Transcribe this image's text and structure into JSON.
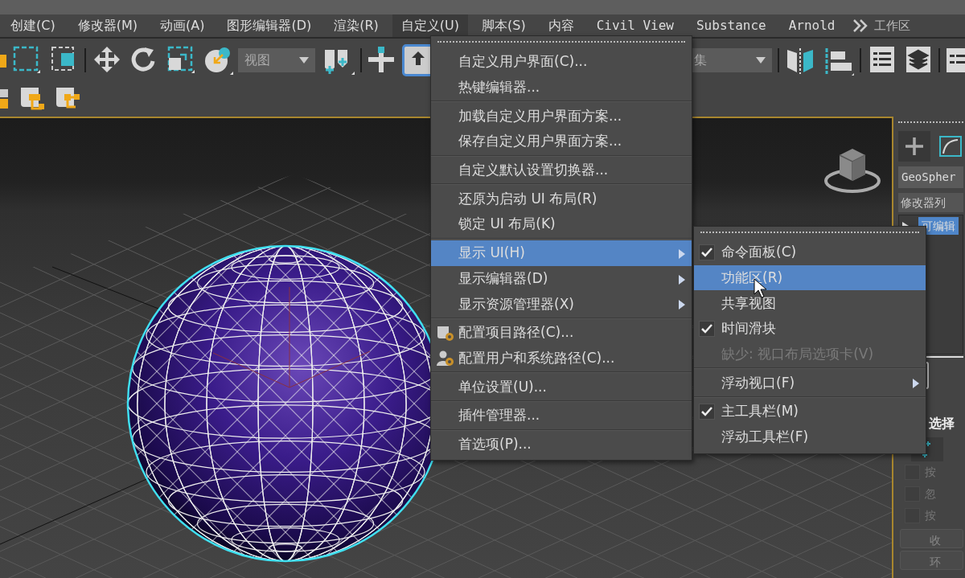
{
  "menu_bar": {
    "items": [
      {
        "label": "创建(C)",
        "selected": false
      },
      {
        "label": "修改器(M)",
        "selected": false
      },
      {
        "label": "动画(A)",
        "selected": false
      },
      {
        "label": "图形编辑器(D)",
        "selected": false
      },
      {
        "label": "渲染(R)",
        "selected": false
      },
      {
        "label": "自定义(U)",
        "selected": true
      },
      {
        "label": "脚本(S)",
        "selected": false
      },
      {
        "label": "内容",
        "selected": false
      },
      {
        "label": "Civil View",
        "selected": false
      },
      {
        "label": "Substance",
        "selected": false
      },
      {
        "label": "Arnold",
        "selected": false
      }
    ],
    "workspace_label": "工作区"
  },
  "toolbar": {
    "view_dropdown": "视图",
    "selection_set_dropdown": "集"
  },
  "command_panel": {
    "object_name": "GeoSpher",
    "modifier_list": "修改器列",
    "stack": [
      {
        "label": "可编辑",
        "selected": true
      }
    ],
    "rollout_title": "选择",
    "options": [
      {
        "label": "按",
        "checked": false,
        "disabled": true
      },
      {
        "label": "忽",
        "checked": false,
        "disabled": true
      },
      {
        "label": "按",
        "checked": false,
        "disabled": true
      }
    ],
    "buttons": [
      "收",
      "环"
    ]
  },
  "menu": {
    "items": [
      {
        "kind": "item",
        "label": "自定义用户界面(C)...",
        "selected": false,
        "submenu": false
      },
      {
        "kind": "item",
        "label": "热键编辑器...",
        "selected": false,
        "submenu": false
      },
      {
        "kind": "separator"
      },
      {
        "kind": "item",
        "label": "加载自定义用户界面方案...",
        "selected": false,
        "submenu": false
      },
      {
        "kind": "item",
        "label": "保存自定义用户界面方案...",
        "selected": false,
        "submenu": false
      },
      {
        "kind": "separator"
      },
      {
        "kind": "item",
        "label": "自定义默认设置切换器...",
        "selected": false,
        "submenu": false
      },
      {
        "kind": "separator"
      },
      {
        "kind": "item",
        "label": "还原为启动 UI 布局(R)",
        "selected": false,
        "submenu": false
      },
      {
        "kind": "item",
        "label": "锁定 UI 布局(K)",
        "selected": false,
        "submenu": false
      },
      {
        "kind": "separator"
      },
      {
        "kind": "item",
        "label": "显示 UI(H)",
        "selected": true,
        "submenu": true
      },
      {
        "kind": "item",
        "label": "显示编辑器(D)",
        "selected": false,
        "submenu": true
      },
      {
        "kind": "item",
        "label": "显示资源管理器(X)",
        "selected": false,
        "submenu": true
      },
      {
        "kind": "separator"
      },
      {
        "kind": "projectpath",
        "label": "配置项目路径(C)...",
        "selected": false,
        "submenu": false
      },
      {
        "kind": "userpath",
        "label": "配置用户和系统路径(C)...",
        "selected": false,
        "submenu": false
      },
      {
        "kind": "separator"
      },
      {
        "kind": "item",
        "label": "单位设置(U)...",
        "selected": false,
        "submenu": false
      },
      {
        "kind": "separator"
      },
      {
        "kind": "item",
        "label": "插件管理器...",
        "selected": false,
        "submenu": false
      },
      {
        "kind": "separator"
      },
      {
        "kind": "item",
        "label": "首选项(P)...",
        "selected": false,
        "submenu": false
      }
    ]
  },
  "submenu": {
    "items": [
      {
        "kind": "item",
        "label": "命令面板(C)",
        "checked": true,
        "selected": false,
        "disabled": false,
        "submenu": false
      },
      {
        "kind": "item",
        "label": "功能区(R)",
        "checked": false,
        "selected": true,
        "disabled": false,
        "submenu": false
      },
      {
        "kind": "item",
        "label": "共享视图",
        "checked": false,
        "selected": false,
        "disabled": false,
        "submenu": false
      },
      {
        "kind": "item",
        "label": "时间滑块",
        "checked": true,
        "selected": false,
        "disabled": false,
        "submenu": false
      },
      {
        "kind": "item",
        "label": "缺少: 视口布局选项卡(V)",
        "checked": false,
        "selected": false,
        "disabled": true,
        "submenu": false
      },
      {
        "kind": "separator"
      },
      {
        "kind": "item",
        "label": "浮动视口(F)",
        "checked": false,
        "selected": false,
        "disabled": false,
        "submenu": true
      },
      {
        "kind": "separator"
      },
      {
        "kind": "item",
        "label": "主工具栏(M)",
        "checked": true,
        "selected": false,
        "disabled": false,
        "submenu": false
      },
      {
        "kind": "item",
        "label": "浮动工具栏(F)",
        "checked": false,
        "selected": false,
        "disabled": false,
        "submenu": false
      }
    ]
  }
}
